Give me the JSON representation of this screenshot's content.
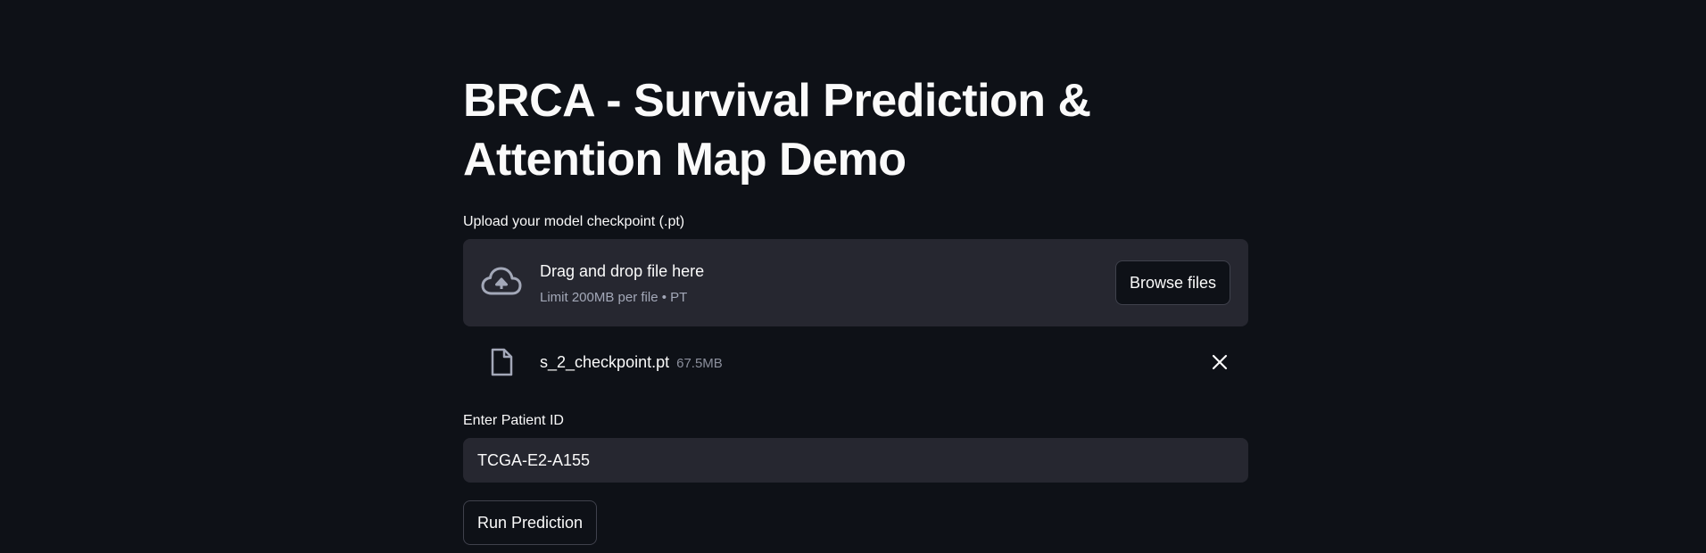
{
  "page": {
    "title": "BRCA - Survival Prediction & Attention Map Demo"
  },
  "uploader": {
    "label": "Upload your model checkpoint (.pt)",
    "dropzone_text": "Drag and drop file here",
    "limit_text": "Limit 200MB per file • PT",
    "browse_label": "Browse files",
    "icon": "cloud-upload-icon",
    "file": {
      "name": "s_2_checkpoint.pt",
      "size": "67.5MB",
      "icon": "file-icon",
      "remove_icon": "close-icon"
    }
  },
  "patient": {
    "label": "Enter Patient ID",
    "value": "TCGA-E2-A155"
  },
  "actions": {
    "run_label": "Run Prediction"
  },
  "colors": {
    "background": "#0e1117",
    "widget_bg": "#262730",
    "text": "#fafafa",
    "muted_text": "#a3a8b8",
    "border": "#3f414c"
  }
}
